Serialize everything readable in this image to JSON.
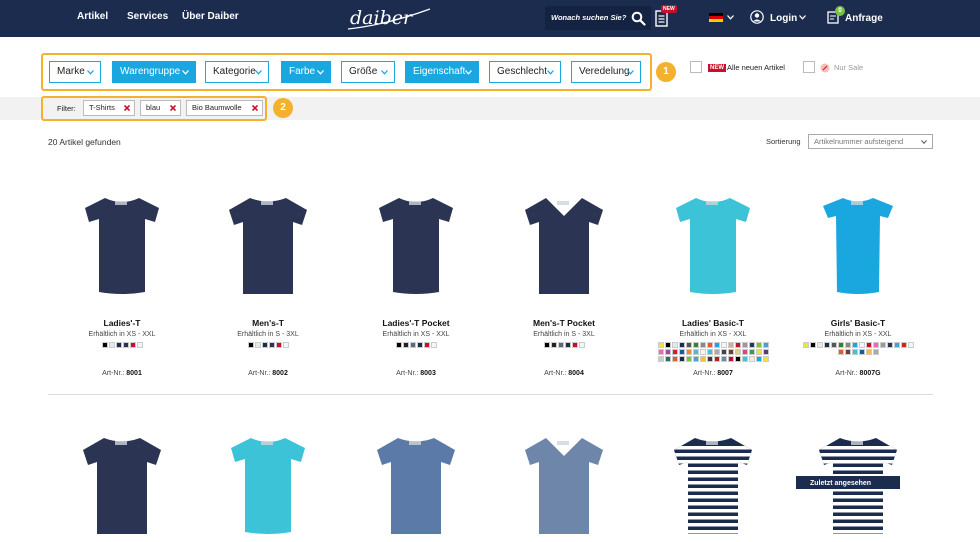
{
  "nav": {
    "items": [
      "Artikel",
      "Services",
      "Über Daiber"
    ],
    "logo_text": "daiber",
    "search_placeholder": "Wonach suchen Sie?",
    "new_tag": "NEW",
    "login": "Login",
    "request": "Anfrage",
    "request_count": "0"
  },
  "filters": {
    "dropdowns": [
      {
        "label": "Marke",
        "active": false
      },
      {
        "label": "Warengruppe",
        "active": true
      },
      {
        "label": "Kategorie",
        "active": false
      },
      {
        "label": "Farbe",
        "active": true
      },
      {
        "label": "Größe",
        "active": false
      },
      {
        "label": "Eigenschaft",
        "active": true
      },
      {
        "label": "Geschlecht",
        "active": false
      },
      {
        "label": "Veredelung",
        "active": false
      }
    ],
    "callout1": "1",
    "callout2": "2",
    "new_badge": "NEW",
    "new_label": "Alle neuen Artikel",
    "sale_label": "Nur Sale",
    "filter_label": "Filter:",
    "chips": [
      "T-Shirts",
      "blau",
      "Bio Baumwolle"
    ]
  },
  "results": {
    "count": "20 Artikel gefunden",
    "sort_label": "Sortierung",
    "sort_value": "Artikelnummer aufsteigend"
  },
  "products": [
    {
      "name": "Ladies'-T",
      "sizes": "Erhältlich in XS - XXL",
      "art_label": "Art-Nr.:",
      "art": "8001",
      "color": "#2b3553",
      "cut": "v0",
      "swatches": [
        "#000000",
        "#e8e8e8",
        "#1b2c4f",
        "#2b3553",
        "#c8102e",
        "#f5f5f5"
      ]
    },
    {
      "name": "Men's-T",
      "sizes": "Erhältlich in S - 3XL",
      "art_label": "Art-Nr.:",
      "art": "8002",
      "color": "#2b3553",
      "cut": "m0",
      "swatches": [
        "#000000",
        "#e8e8e8",
        "#1b2c4f",
        "#2b3553",
        "#c8102e",
        "#f5f5f5"
      ]
    },
    {
      "name": "Ladies'-T Pocket",
      "sizes": "Erhältlich in XS - XXL",
      "art_label": "Art-Nr.:",
      "art": "8003",
      "color": "#2b3553",
      "cut": "v0",
      "swatches": [
        "#000000",
        "#222222",
        "#5a6a7a",
        "#1b2c4f",
        "#c8102e",
        "#f5f5f5"
      ]
    },
    {
      "name": "Men's-T Pocket",
      "sizes": "Erhältlich in S - 3XL",
      "art_label": "Art-Nr.:",
      "art": "8004",
      "color": "#2b3553",
      "cut": "mv",
      "swatches": [
        "#000000",
        "#222222",
        "#5a6a7a",
        "#1b2c4f",
        "#c8102e",
        "#f5f5f5"
      ]
    },
    {
      "name": "Ladies' Basic-T",
      "sizes": "Erhältlich in XS - XXL",
      "art_label": "Art-Nr.:",
      "art": "8007",
      "color": "#3cc3d8",
      "cut": "v0",
      "swatches": [
        "#f3e23a",
        "#000000",
        "#e8e8e8",
        "#1b2c4f",
        "#555555",
        "#3a7d3a",
        "#888888",
        "#e85a2c",
        "#1aa7e0",
        "#f5f5f5",
        "#d0b090",
        "#c8102e",
        "#999999",
        "#2b3553",
        "#7ac143",
        "#4aa0d0",
        "#e86ab0",
        "#9a4ab0",
        "#cc2222",
        "#1a5a9a",
        "#ee8a2a",
        "#60b0e0",
        "#f5f5f5",
        "#3cc3d8",
        "#aaaaaa",
        "#444444",
        "#7a3a2a",
        "#e0d080",
        "#dd4488",
        "#3a9a5a",
        "#f3e23a",
        "#5a3a7a",
        "#cccccc",
        "#2a6a6a",
        "#e85a2c",
        "#1b2c4f",
        "#7ac143",
        "#4aa0d0",
        "#f5c030",
        "#3a3a3a",
        "#aa2222",
        "#6a8aaa",
        "#c8102e",
        "#000000",
        "#3cc3d8",
        "#eeeeee",
        "#1aa7e0",
        "#f3e23a"
      ]
    },
    {
      "name": "Girls' Basic-T",
      "sizes": "Erhältlich in XS - XXL",
      "art_label": "Art-Nr.:",
      "art": "8007G",
      "color": "#1aa7e0",
      "cut": "g",
      "swatches": [
        "#f3e23a",
        "#000000",
        "#e8e8e8",
        "#1b2c4f",
        "#555555",
        "#3a7d3a",
        "#888888",
        "#1aa7e0",
        "#f5f5f5",
        "#c8102e",
        "#e86ab0",
        "#999999",
        "#2b3553",
        "#4aa0d0",
        "#cc2222",
        "#f5f5f5",
        "#e85a2c",
        "#7a3a2a",
        "#3cc3d8",
        "#1a5a9a",
        "#f5c030",
        "#aaaaaa"
      ]
    },
    {
      "name": "",
      "sizes": "",
      "art_label": "",
      "art": "",
      "color": "#2b3553",
      "cut": "m0",
      "swatches": []
    },
    {
      "name": "",
      "sizes": "",
      "art_label": "",
      "art": "",
      "color": "#3cc3d8",
      "cut": "v0",
      "swatches": []
    },
    {
      "name": "",
      "sizes": "",
      "art_label": "",
      "art": "",
      "color": "#5b7aa8",
      "cut": "m0",
      "swatches": []
    },
    {
      "name": "",
      "sizes": "",
      "art_label": "",
      "art": "",
      "color": "#6e86aa",
      "cut": "mv",
      "swatches": []
    },
    {
      "name": "",
      "sizes": "",
      "art_label": "",
      "art": "",
      "color": "#1b2c4f",
      "cut": "stripe",
      "swatches": []
    },
    {
      "name": "",
      "sizes": "",
      "art_label": "",
      "art": "",
      "color": "#1b2c4f",
      "cut": "stripe",
      "swatches": []
    }
  ],
  "recent": "Zuletzt angesehen",
  "colors": {
    "navy": "#1b2c4f",
    "accent": "#1aa7e0",
    "callout": "#f3b12d",
    "new_red": "#c8102e"
  }
}
